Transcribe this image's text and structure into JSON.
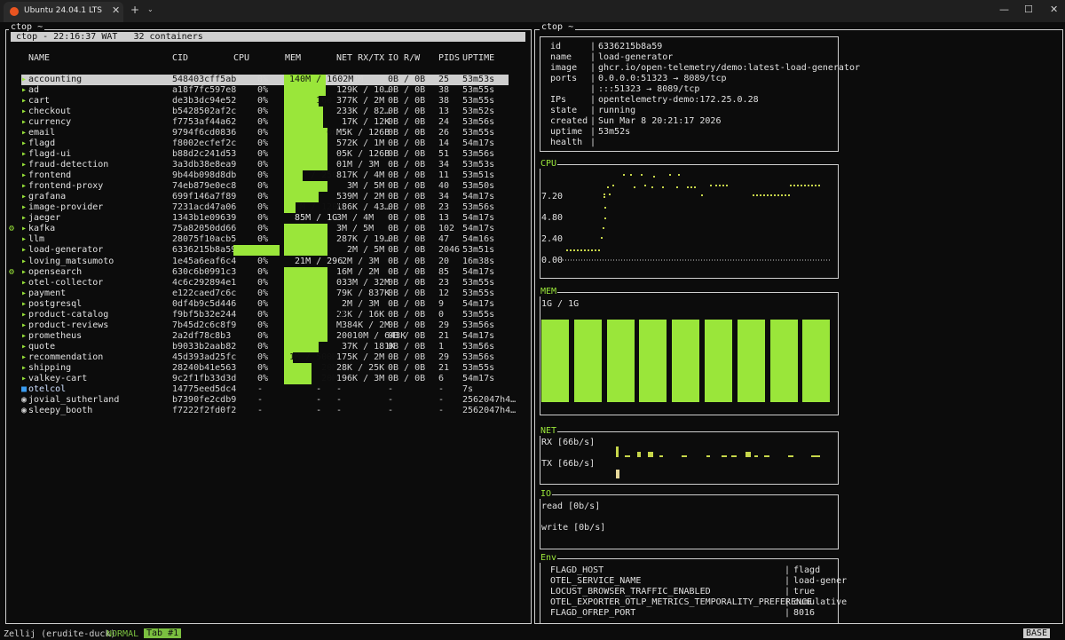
{
  "window": {
    "tab_title": "Ubuntu 24.04.1 LTS",
    "close_glyph": "✕",
    "add_glyph": "+",
    "dropdown_glyph": "⌄",
    "minimize_glyph": "—",
    "maximize_glyph": "☐",
    "close_window_glyph": "✕",
    "accent_color": "#e95420"
  },
  "left_pane": {
    "title": "ctop ~",
    "status": " ctop - 22:16:37 WAT   32 containers",
    "headers": {
      "name": "NAME",
      "cid": "CID",
      "cpu": "CPU",
      "mem": "MEM",
      "net": "NET RX/TX",
      "io": "IO R/W",
      "pids": "PIDS",
      "uptime": "UPTIME"
    },
    "rows": [
      {
        "mark": "▸",
        "name": "accounting",
        "cid": "548403cff5ab",
        "cpu": "0%",
        "mem": " 140M / 1602M",
        "net": " / 2M",
        "io": "0B / 0B",
        "pids": "25",
        "uptime": "53m53s",
        "memfill": 0.9
      },
      {
        "mark": "▸",
        "name": "ad",
        "cid": "a18f7fc597e8",
        "cpu": "0%",
        "mem": "",
        "net": "129K / 10…",
        "io": "0B / 0B",
        "pids": "38",
        "uptime": "53m55s",
        "memfill": 0.9
      },
      {
        "mark": "▸",
        "name": "cart",
        "cid": "de3b3dc94e52",
        "cpu": "0%",
        "mem": "      160",
        "net": "377K / 2M",
        "io": "0B / 0B",
        "pids": "38",
        "uptime": "53m55s",
        "memfill": 0.75
      },
      {
        "mark": "▸",
        "name": "checkout",
        "cid": "b5428502af2c",
        "cpu": "0%",
        "mem": "",
        "net": "233K / 82…",
        "io": "0B / 0B",
        "pids": "13",
        "uptime": "53m52s",
        "memfill": 0.85
      },
      {
        "mark": "▸",
        "name": "currency",
        "cid": "f7753af44a62",
        "cpu": "0%",
        "mem": "",
        "net": " 17K / 12K",
        "io": "0B / 0B",
        "pids": "24",
        "uptime": "53m56s",
        "memfill": 0.85
      },
      {
        "mark": "▸",
        "name": "email",
        "cid": "9794f6cd0836",
        "cpu": "0%",
        "mem": "        00",
        "net": "M5K / 126B",
        "io": "0B / 0B",
        "pids": "26",
        "uptime": "53m55s",
        "memfill": 0.95
      },
      {
        "mark": "▸",
        "name": "flagd",
        "cid": "f8002ecfef2c",
        "cpu": "0%",
        "mem": "",
        "net": "572K / 1M",
        "io": "0B / 0B",
        "pids": "14",
        "uptime": "54m17s",
        "memfill": 0.95
      },
      {
        "mark": "▸",
        "name": "flagd-ui",
        "cid": "b88d2c241d53",
        "cpu": "0%",
        "mem": "",
        "net": "05K / 126B",
        "io": "0B / 0B",
        "pids": "51",
        "uptime": "53m56s",
        "memfill": 0.95
      },
      {
        "mark": "▸",
        "name": "fraud-detection",
        "cid": "3a3db38e8ea9",
        "cpu": "0%",
        "mem": "",
        "net": "01M / 3M",
        "io": "0B / 0B",
        "pids": "34",
        "uptime": "53m53s",
        "memfill": 0.95
      },
      {
        "mark": "▸",
        "name": "frontend",
        "cid": "9b44b098d8db",
        "cpu": "0%",
        "mem": "     / 250",
        "net": "817K / 4M",
        "io": "0B / 0B",
        "pids": "11",
        "uptime": "53m51s",
        "memfill": 0.4
      },
      {
        "mark": "▸",
        "name": "frontend-proxy",
        "cid": "74eb879e0ec8",
        "cpu": "0%",
        "mem": "",
        "net": "  3M / 5M",
        "io": "0B / 0B",
        "pids": "40",
        "uptime": "53m50s",
        "memfill": 0.95
      },
      {
        "mark": "▸",
        "name": "grafana",
        "cid": "699f146a7f89",
        "cpu": "0%",
        "mem": "",
        "net": "539M / 2M",
        "io": "0B / 0B",
        "pids": "34",
        "uptime": "54m17s",
        "memfill": 0.75
      },
      {
        "mark": "▸",
        "name": "image-provider",
        "cid": "7231acd47a06",
        "cpu": "0%",
        "mem": "   M / 120M",
        "net": "186K / 43…",
        "io": "0B / 0B",
        "pids": "23",
        "uptime": "53m56s",
        "memfill": 0.25
      },
      {
        "mark": "▸",
        "name": "jaeger",
        "cid": "1343b1e09639",
        "cpu": "0%",
        "mem": "  85M / 1G",
        "net": "3M / 4M",
        "io": "0B / 0B",
        "pids": "13",
        "uptime": "54m17s",
        "memfill": 0
      },
      {
        "mark": "▸",
        "name": "kafka",
        "cid": "75a82050dd66",
        "cpu": "0%",
        "mem": "",
        "net": "3M / 5M",
        "io": "0B / 0B",
        "pids": "102",
        "uptime": "54m17s",
        "memfill": 0.95,
        "gear": true
      },
      {
        "mark": "▸",
        "name": "llm",
        "cid": "28075f10acb5",
        "cpu": "0%",
        "mem": "",
        "net": "287K / 19…",
        "io": "0B / 0B",
        "pids": "47",
        "uptime": "54m16s",
        "memfill": 0.95
      },
      {
        "mark": "▸",
        "name": "load-generator",
        "cid": "6336215b8a59",
        "cpu": "",
        "mem": "",
        "net": "  2M / 5M",
        "io": "0B / 0B",
        "pids": "2046",
        "uptime": "53m51s",
        "memfill": 0.95,
        "cpufill": true
      },
      {
        "mark": "▸",
        "name": "loving_matsumoto",
        "cid": "1e45a6eaf6c4",
        "cpu": "0%",
        "mem": "  21M / 296",
        "net": " 2M / 3M",
        "io": "0B / 0B",
        "pids": "20",
        "uptime": "16m38s",
        "memfill": 0
      },
      {
        "mark": "▸",
        "name": "opensearch",
        "cid": "630c6b0991c3",
        "cpu": "0%",
        "mem": "",
        "net": "16M / 2M",
        "io": "0B / 0B",
        "pids": "85",
        "uptime": "54m17s",
        "memfill": 0.95,
        "gear": true
      },
      {
        "mark": "▸",
        "name": "otel-collector",
        "cid": "4c6c292894e1",
        "cpu": "0%",
        "mem": "",
        "net": "033M / 32M",
        "io": "0B / 0B",
        "pids": "23",
        "uptime": "53m55s",
        "memfill": 0.95
      },
      {
        "mark": "▸",
        "name": "payment",
        "cid": "e122caed7c6c",
        "cpu": "0%",
        "mem": "",
        "net": "79K / 837K",
        "io": "0B / 0B",
        "pids": "12",
        "uptime": "53m55s",
        "memfill": 0.95
      },
      {
        "mark": "▸",
        "name": "postgresql",
        "cid": "0df4b9c5d446",
        "cpu": "0%",
        "mem": "",
        "net": " 2M / 3M",
        "io": "0B / 0B",
        "pids": "9",
        "uptime": "54m17s",
        "memfill": 0.95
      },
      {
        "mark": "▸",
        "name": "product-catalog",
        "cid": "f9bf5b32e244",
        "cpu": "0%",
        "mem": "          0M",
        "net": "23K / 16K",
        "io": "0B / 0B",
        "pids": "0",
        "uptime": "53m55s",
        "memfill": 0.95
      },
      {
        "mark": "▸",
        "name": "product-reviews",
        "cid": "7b45d2c6c8f9",
        "cpu": "0%",
        "mem": "",
        "net": "M384K / 2M",
        "io": "0B / 0B",
        "pids": "29",
        "uptime": "53m56s",
        "memfill": 0.95
      },
      {
        "mark": "▸",
        "name": "prometheus",
        "cid": "2a2df78c8b3",
        "cpu": "0%",
        "mem": "",
        "net": "20010M / 643K",
        "io": "0B / 0B",
        "pids": "21",
        "uptime": "54m17s",
        "memfill": 0.95
      },
      {
        "mark": "▸",
        "name": "quote",
        "cid": "b9033b2aab82",
        "cpu": "0%",
        "mem": "",
        "net": " 37K / 181K",
        "io": "0B / 0B",
        "pids": "1",
        "uptime": "53m56s",
        "memfill": 0.75
      },
      {
        "mark": "▸",
        "name": "recommendation",
        "cid": "45d393ad25fc",
        "cpu": "0%",
        "mem": " 1M / 500M",
        "net": "175K / 2M",
        "io": "0B / 0B",
        "pids": "29",
        "uptime": "53m56s",
        "memfill": 0.2
      },
      {
        "mark": "▸",
        "name": "shipping",
        "cid": "28240b41e563",
        "cpu": "0%",
        "mem": "       20M",
        "net": "28K / 25K",
        "io": "0B / 0B",
        "pids": "21",
        "uptime": "53m55s",
        "memfill": 0.6
      },
      {
        "mark": "▸",
        "name": "valkey-cart",
        "cid": "9c2f1fb33d3d",
        "cpu": "0%",
        "mem": "       20M",
        "net": "196K / 3M",
        "io": "0B / 0B",
        "pids": "6",
        "uptime": "54m17s",
        "memfill": 0.6
      },
      {
        "mark": "■",
        "name": "otelcol",
        "cid": "14775eed5dc4",
        "cpu": "-",
        "mem": "      -",
        "net": "-",
        "io": "-",
        "pids": "-",
        "uptime": "7s",
        "memfill": 0,
        "markcolor": "#3a9cf0"
      },
      {
        "mark": "◉",
        "name": "jovial_sutherland",
        "cid": "b7390fe2cdb9",
        "cpu": "-",
        "mem": "      -",
        "net": "-",
        "io": "-",
        "pids": "-",
        "uptime": "2562047h4…",
        "memfill": 0,
        "markcolor": "#cfcfcf"
      },
      {
        "mark": "◉",
        "name": "sleepy_booth",
        "cid": "f7222f2fd0f2",
        "cpu": "-",
        "mem": "      -",
        "net": "-",
        "io": "-",
        "pids": "-",
        "uptime": "2562047h4…",
        "memfill": 0,
        "markcolor": "#cfcfcf"
      }
    ]
  },
  "right_pane": {
    "title": "ctop ~",
    "info": [
      {
        "k": "id",
        "v": "6336215b8a59"
      },
      {
        "k": "name",
        "v": "load-generator"
      },
      {
        "k": "image",
        "v": "ghcr.io/open-telemetry/demo:latest-load-generator"
      },
      {
        "k": "ports",
        "v": "0.0.0.0:51323 → 8089/tcp"
      },
      {
        "k": "",
        "v": ":::51323 → 8089/tcp"
      },
      {
        "k": "IPs",
        "v": "opentelemetry-demo:172.25.0.28"
      },
      {
        "k": "state",
        "v": "running"
      },
      {
        "k": "created",
        "v": "Sun Mar 8 20:21:17 2026"
      },
      {
        "k": "uptime",
        "v": "53m52s"
      },
      {
        "k": "health",
        "v": ""
      }
    ],
    "cpu": {
      "label": "CPU",
      "ticks": [
        "7.20",
        "4.80",
        "2.40",
        "0.00"
      ]
    },
    "mem": {
      "label": "MEM",
      "text": "1G / 1G",
      "bars": 9
    },
    "net": {
      "label": "NET",
      "rx": "RX [66b/s]",
      "tx": "TX [66b/s]"
    },
    "io": {
      "label": "IO",
      "read": "read [0b/s]",
      "write": "write [0b/s]"
    },
    "env": {
      "label": "Env",
      "rows": [
        {
          "k": "FLAGD_HOST",
          "v": "flagd"
        },
        {
          "k": "OTEL_SERVICE_NAME",
          "v": "load-gener"
        },
        {
          "k": "LOCUST_BROWSER_TRAFFIC_ENABLED",
          "v": "true"
        },
        {
          "k": "OTEL_EXPORTER_OTLP_METRICS_TEMPORALITY_PREFERENCE",
          "v": "cumulative"
        },
        {
          "k": "FLAGD_OFREP_PORT",
          "v": "8016"
        }
      ]
    }
  },
  "bottom": {
    "session": "Zellij (erudite-duck)",
    "mode": "NORMAL",
    "tab": "Tab #1",
    "base": "BASE"
  }
}
